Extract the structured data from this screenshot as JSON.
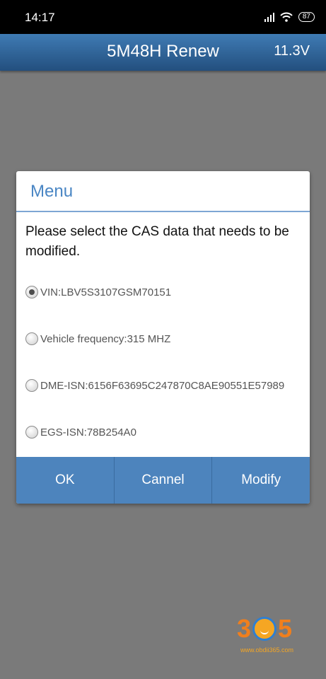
{
  "status_bar": {
    "time": "14:17",
    "battery": "87",
    "icons": [
      "signal-icon",
      "wifi-icon",
      "battery-icon"
    ]
  },
  "header": {
    "title": "5M48H Renew",
    "voltage": "11.3V"
  },
  "dialog": {
    "title": "Menu",
    "message": "Please select the CAS data that needs to be modified.",
    "options": [
      {
        "label": "VIN:LBV5S3107GSM70151",
        "selected": true
      },
      {
        "label": "Vehicle frequency:315 MHZ",
        "selected": false
      },
      {
        "label": "DME-ISN:6156F63695C247870C8AE90551E57989",
        "selected": false
      },
      {
        "label": "EGS-ISN:78B254A0",
        "selected": false
      }
    ],
    "buttons": {
      "ok": "OK",
      "cancel": "Cannel",
      "modify": "Modify"
    }
  },
  "watermark": {
    "digits": [
      "3",
      "5"
    ],
    "url": "www.obdii365.com"
  },
  "colors": {
    "header": "#2f639a",
    "accent": "#4a86c4",
    "button_bar": "#4d84bd",
    "backdrop": "#7a7a7a"
  }
}
